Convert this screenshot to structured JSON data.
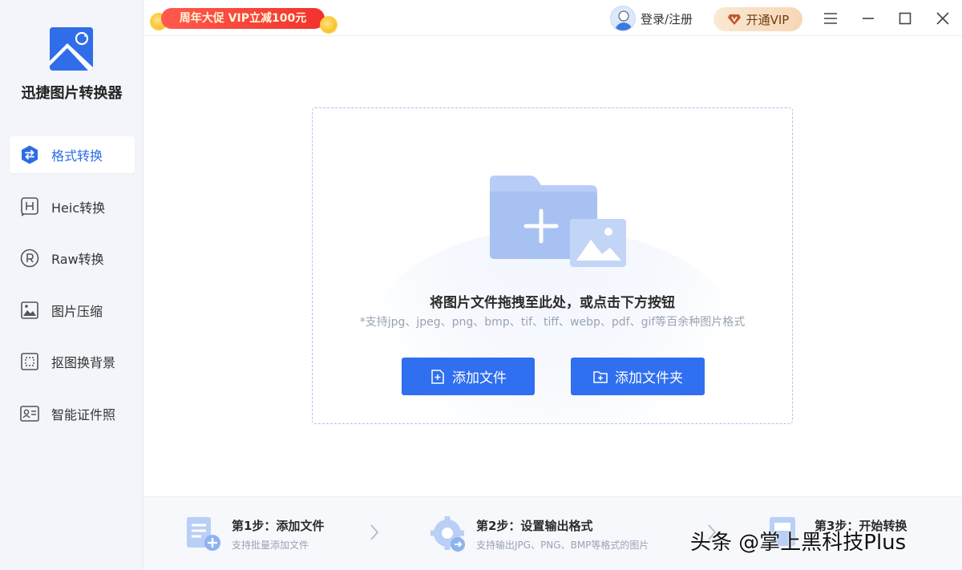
{
  "app": {
    "name": "迅捷图片转换器"
  },
  "colors": {
    "accent": "#2f6ff0",
    "sidebar_bg": "#f3f5fa",
    "promo": "#f2322d",
    "vip": "#f7d7b4"
  },
  "sidebar": {
    "items": [
      {
        "label": "格式转换",
        "icon": "swap-arrows-icon",
        "active": true
      },
      {
        "label": "Heic转换",
        "icon": "heic-icon",
        "active": false
      },
      {
        "label": "Raw转换",
        "icon": "raw-icon",
        "active": false
      },
      {
        "label": "图片压缩",
        "icon": "image-compress-icon",
        "active": false
      },
      {
        "label": "抠图换背景",
        "icon": "cutout-icon",
        "active": false
      },
      {
        "label": "智能证件照",
        "icon": "id-photo-icon",
        "active": false
      }
    ]
  },
  "topbar": {
    "promo": "周年大促 VIP立减100元",
    "user_label": "登录/注册",
    "vip_label": "开通VIP",
    "icons": [
      "menu-icon",
      "minimize-icon",
      "maximize-icon",
      "close-icon"
    ]
  },
  "dropzone": {
    "title": "将图片文件拖拽至此处，或点击下方按钮",
    "subtitle": "*支持jpg、jpeg、png、bmp、tif、tiff、webp、pdf、gif等百余种图片格式",
    "add_file": "添加文件",
    "add_folder": "添加文件夹"
  },
  "steps": [
    {
      "title": "第1步：添加文件",
      "desc": "支持批量添加文件"
    },
    {
      "title": "第2步：设置输出格式",
      "desc": "支持输出JPG、PNG、BMP等格式的图片"
    },
    {
      "title": "第3步：开始转换",
      "desc": ""
    }
  ],
  "watermark": "头条 @掌上黑科技Plus"
}
